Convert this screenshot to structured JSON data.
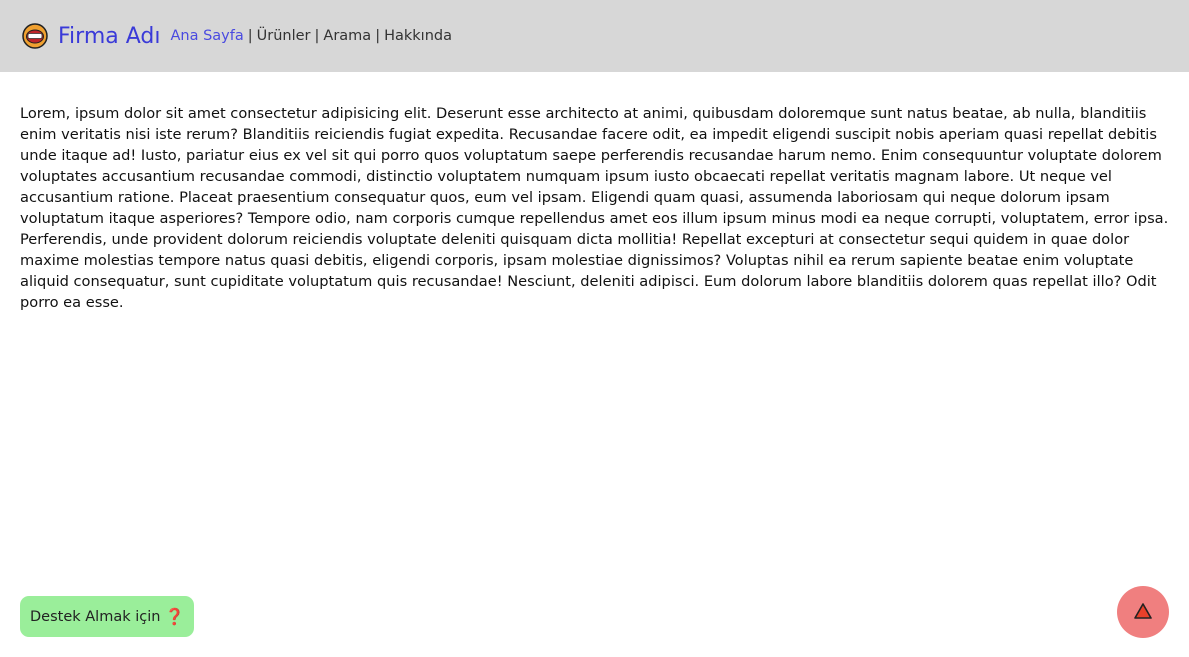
{
  "header": {
    "brand": "Firma Adı",
    "nav": [
      {
        "label": "Ana Sayfa",
        "active": true
      },
      {
        "label": "Ürünler",
        "active": false
      },
      {
        "label": "Arama",
        "active": false
      },
      {
        "label": "Hakkında",
        "active": false
      }
    ],
    "separator": "|",
    "logo_icon": "mouth-emoji-icon"
  },
  "main": {
    "text": "Lorem, ipsum dolor sit amet consectetur adipisicing elit. Deserunt esse architecto at animi, quibusdam doloremque sunt natus beatae, ab nulla, blanditiis enim veritatis nisi iste rerum? Blanditiis reiciendis fugiat expedita. Recusandae facere odit, ea impedit eligendi suscipit nobis aperiam quasi repellat debitis unde itaque ad! Iusto, pariatur eius ex vel sit qui porro quos voluptatum saepe perferendis recusandae harum nemo. Enim consequuntur voluptate dolorem voluptates accusantium recusandae commodi, distinctio voluptatem numquam ipsum iusto obcaecati repellat veritatis magnam labore. Ut neque vel accusantium ratione. Placeat praesentium consequatur quos, eum vel ipsam. Eligendi quam quasi, assumenda laboriosam qui neque dolorum ipsam voluptatum itaque asperiores? Tempore odio, nam corporis cumque repellendus amet eos illum ipsum minus modi ea neque corrupti, voluptatem, error ipsa. Perferendis, unde provident dolorum reiciendis voluptate deleniti quisquam dicta mollitia! Repellat excepturi at consectetur sequi quidem in quae dolor maxime molestias tempore natus quasi debitis, eligendi corporis, ipsam molestiae dignissimos? Voluptas nihil ea rerum sapiente beatae enim voluptate aliquid consequatur, sunt cupiditate voluptatum quis recusandae! Nesciunt, deleniti adipisci. Eum dolorum labore blanditiis dolorem quas repellat illo? Odit porro ea esse."
  },
  "support": {
    "label": "Destek Almak için",
    "icon_glyph": "❓",
    "icon": "red-question-mark-icon"
  },
  "scroll_top": {
    "icon": "triangle-up-icon"
  },
  "colors": {
    "header_bg": "#d7d7d7",
    "brand": "#3a3ad8",
    "active_nav": "#4a4ae0",
    "support_bg": "#9aee9a",
    "scroll_top_bg": "#f07f7f"
  }
}
